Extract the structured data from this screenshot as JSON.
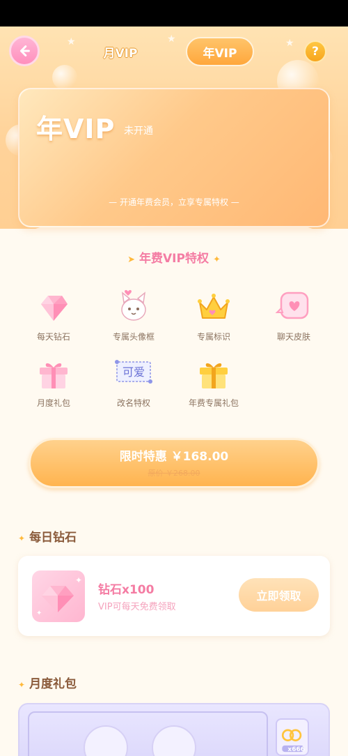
{
  "header": {
    "tab_month": "月VIP",
    "tab_year": "年VIP",
    "help": "?"
  },
  "vip_card": {
    "title": "年VIP",
    "status": "未开通",
    "tagline": "— 开通年费会员，立享专属特权 —"
  },
  "benefits": {
    "title": "年费VIP特权",
    "items": [
      {
        "label": "每天钻石",
        "icon": "diamond-icon"
      },
      {
        "label": "专属头像框",
        "icon": "avatar-frame-icon"
      },
      {
        "label": "专属标识",
        "icon": "crown-icon"
      },
      {
        "label": "聊天皮肤",
        "icon": "chat-bubble-icon"
      },
      {
        "label": "月度礼包",
        "icon": "gift-box-icon"
      },
      {
        "label": "改名特权",
        "icon": "rename-icon"
      },
      {
        "label": "年费专属礼包",
        "icon": "gold-gift-icon"
      }
    ],
    "rename_icon_text": "可爱"
  },
  "purchase": {
    "price_label": "限时特惠 ￥168.00",
    "original_price": "原价 ￥268.00"
  },
  "daily_diamond": {
    "section_title": "每日钻石",
    "name": "钻石x100",
    "desc": "VIP可每天免费领取",
    "claim_label": "立即领取"
  },
  "monthly_gift": {
    "section_title": "月度礼包",
    "item_count": "x666"
  },
  "colors": {
    "accent_pink": "#f47ca3",
    "accent_orange": "#ffb44f",
    "background": "#fffaf1"
  }
}
